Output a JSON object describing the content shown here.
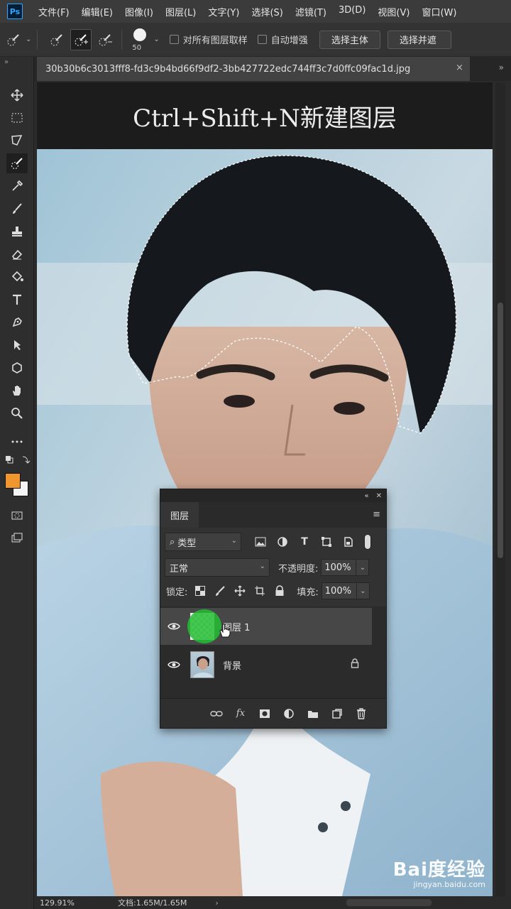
{
  "app": {
    "logo": "Ps"
  },
  "menu": [
    "文件(F)",
    "编辑(E)",
    "图像(I)",
    "图层(L)",
    "文字(Y)",
    "选择(S)",
    "滤镜(T)",
    "3D(D)",
    "视图(V)",
    "窗口(W)"
  ],
  "options": {
    "brush_size": "50",
    "sample_all_layers": "对所有图层取样",
    "auto_enhance": "自动增强",
    "select_subject": "选择主体",
    "select_and_mask": "选择并遮"
  },
  "document": {
    "tab_title": "30b30b6c3013fff8-fd3c9b4bd66f9df2-3bb427722edc744ff3c7d0ffc09fac1d.jpg",
    "caption": "Ctrl+Shift+N新建图层"
  },
  "status": {
    "zoom": "129.91%",
    "docinfo": "文档:1.65M/1.65M"
  },
  "layers_panel": {
    "tab_label": "图层",
    "filter_label": "类型",
    "blend_mode": "正常",
    "opacity_label": "不透明度:",
    "opacity_value": "100%",
    "lock_label": "锁定:",
    "fill_label": "填充:",
    "fill_value": "100%",
    "layers": [
      {
        "name": "图层 1",
        "selected": true,
        "transparent": true
      },
      {
        "name": "背景",
        "selected": false,
        "locked": true
      }
    ]
  },
  "colors": {
    "foreground": "#f0962e",
    "background": "#f4f4f4",
    "accent": "#31a8ff"
  },
  "watermark": {
    "main": "Bai度经验",
    "sub": "jingyan.baidu.com"
  }
}
